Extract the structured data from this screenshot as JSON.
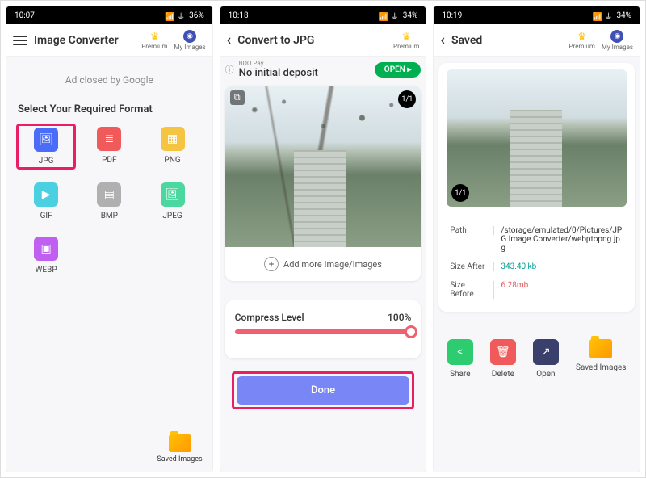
{
  "status": {
    "time1": "10:07",
    "time2": "10:18",
    "time3": "10:19",
    "batt1": "36%",
    "batt2": "34%",
    "batt3": "34%"
  },
  "screen1": {
    "title": "Image Converter",
    "premium": "Premium",
    "myimages": "My Images",
    "ad": "Ad closed by Google",
    "section": "Select Your Required Format",
    "formats": [
      {
        "label": "JPG",
        "color": "#4a6cf7",
        "glyph": "🖼"
      },
      {
        "label": "PDF",
        "color": "#f05a5a",
        "glyph": "≣"
      },
      {
        "label": "PNG",
        "color": "#f5c542",
        "glyph": "▦"
      },
      {
        "label": "GIF",
        "color": "#4ad0e0",
        "glyph": "▶"
      },
      {
        "label": "BMP",
        "color": "#b0b0b0",
        "glyph": "▤"
      },
      {
        "label": "JPEG",
        "color": "#4ad8a0",
        "glyph": "🖼"
      },
      {
        "label": "WEBP",
        "color": "#c060f0",
        "glyph": "▣"
      }
    ],
    "saved": "Saved Images"
  },
  "screen2": {
    "title": "Convert to JPG",
    "premium": "Premium",
    "bdo_small": "BDO Pay",
    "bdo_big": "No initial deposit",
    "open": "OPEN",
    "count": "1/1",
    "addmore": "Add more Image/Images",
    "compress": "Compress Level",
    "compress_val": "100%",
    "done": "Done"
  },
  "screen3": {
    "title": "Saved",
    "premium": "Premium",
    "myimages": "My Images",
    "count": "1/1",
    "path_label": "Path",
    "path_val": "/storage/emulated/0/Pictures/JPG Image Converter/webptopng.jpg",
    "sizea_label": "Size After",
    "sizea_val": "343.40 kb",
    "sizeb_label": "Size Before",
    "sizeb_val": "6.28mb",
    "actions": [
      {
        "label": "Share",
        "color": "#2ecc71",
        "glyph": "<"
      },
      {
        "label": "Delete",
        "color": "#f05a5a",
        "glyph": "🗑"
      },
      {
        "label": "Open",
        "color": "#3a3f6b",
        "glyph": "↗"
      },
      {
        "label": "Saved Images",
        "color": "",
        "glyph": "folder"
      }
    ]
  }
}
